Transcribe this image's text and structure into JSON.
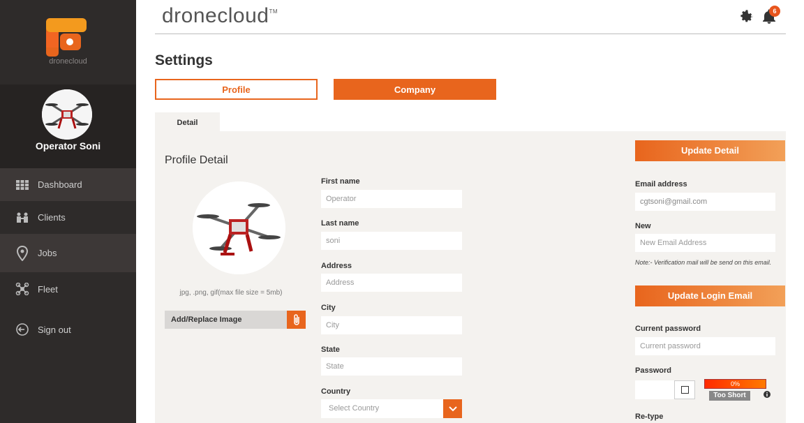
{
  "app": {
    "title": "dronecloud",
    "trademark": "TM",
    "logo_text": "dronecloud"
  },
  "user": {
    "name": "Operator Soni"
  },
  "nav": [
    {
      "label": "Dashboard",
      "icon": "grid-icon"
    },
    {
      "label": "Clients",
      "icon": "clients-icon"
    },
    {
      "label": "Jobs",
      "icon": "map-pin-icon"
    },
    {
      "label": "Fleet",
      "icon": "drone-icon"
    },
    {
      "label": "Sign out",
      "icon": "sign-out-icon"
    }
  ],
  "header": {
    "notification_count": "6"
  },
  "page": {
    "title": "Settings"
  },
  "tabs": {
    "profile": "Profile",
    "company": "Company",
    "detail": "Detail"
  },
  "profile": {
    "section_title": "Profile Detail",
    "image_hint": "jpg, .png, gif(max file size = 5mb)",
    "add_image_label": "Add/Replace Image"
  },
  "form": {
    "first_name": {
      "label": "First name",
      "value": "Operator"
    },
    "last_name": {
      "label": "Last name",
      "value": "soni"
    },
    "address": {
      "label": "Address",
      "placeholder": "Address"
    },
    "city": {
      "label": "City",
      "placeholder": "City"
    },
    "state": {
      "label": "State",
      "placeholder": "State"
    },
    "country": {
      "label": "Country",
      "selected": "Select Country"
    }
  },
  "account": {
    "update_detail_label": "Update Detail",
    "email_label": "Email address",
    "email_value": "cgtsoni@gmail.com",
    "new_label": "New",
    "new_placeholder": "New Email Address",
    "note": "Note:- Verification mail will be send on this email.",
    "update_login_label": "Update Login Email",
    "current_password_label": "Current password",
    "current_password_placeholder": "Current password",
    "password_label": "Password",
    "strength_percent": "0%",
    "strength_label": "Too Short",
    "retype_label": "Re-type"
  },
  "colors": {
    "accent": "#e8651d",
    "sidebar": "#2e2b2a",
    "panel": "#f4f2ef"
  }
}
